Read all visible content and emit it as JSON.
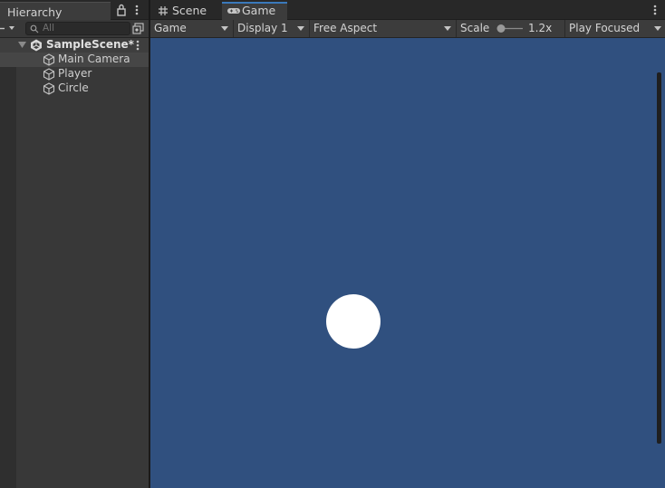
{
  "hierarchy": {
    "tab_label": "Hierarchy",
    "search_placeholder": "All",
    "scene": {
      "name": "SampleScene*",
      "objects": [
        "Main Camera",
        "Player",
        "Circle"
      ],
      "selected_object": "Main Camera"
    }
  },
  "game": {
    "tabs": [
      {
        "label": "Scene",
        "icon": "grid-icon",
        "active": false
      },
      {
        "label": "Game",
        "icon": "gamepad-icon",
        "active": true
      }
    ],
    "toolbar": {
      "view_mode": "Game",
      "display": "Display 1",
      "aspect": "Free Aspect",
      "scale_label": "Scale",
      "scale_value": "1.2x",
      "play_mode": "Play Focused"
    },
    "viewport": {
      "background_color": "#30507f",
      "circle_color": "#ffffff"
    }
  },
  "colors": {
    "accent": "#3a79bb",
    "panel": "#383838",
    "tabbar": "#282828"
  }
}
